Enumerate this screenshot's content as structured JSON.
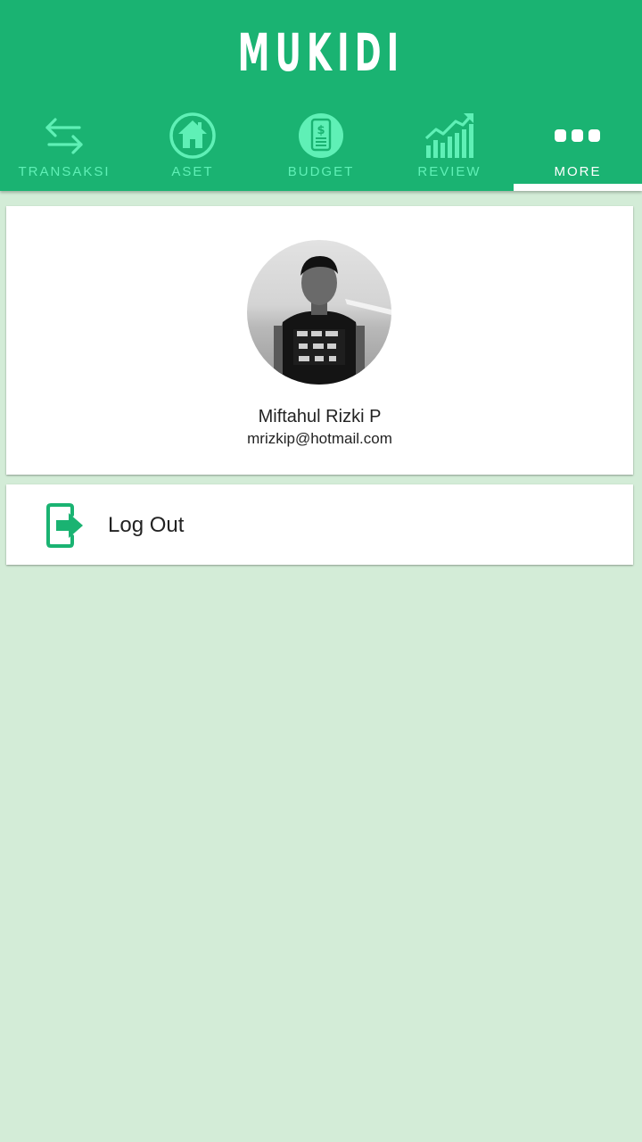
{
  "app": {
    "title": "MUKIDI"
  },
  "tabs": [
    {
      "label": "TRANSAKSI",
      "icon": "swap-arrows-icon",
      "active": false
    },
    {
      "label": "ASET",
      "icon": "home-icon",
      "active": false
    },
    {
      "label": "BUDGET",
      "icon": "dollar-document-icon",
      "active": false
    },
    {
      "label": "REVIEW",
      "icon": "growth-chart-icon",
      "active": false
    },
    {
      "label": "MORE",
      "icon": "more-dots-icon",
      "active": true
    }
  ],
  "profile": {
    "name": "Miftahul Rizki P",
    "email": "mrizkip@hotmail.com"
  },
  "actions": {
    "logout_label": "Log Out",
    "logout_icon": "logout-icon"
  },
  "colors": {
    "primary": "#1ab372",
    "tab_inactive": "#5ff0b6",
    "tab_active": "#ffffff",
    "background": "#d3ecd7",
    "logout_icon": "#1ab372"
  }
}
